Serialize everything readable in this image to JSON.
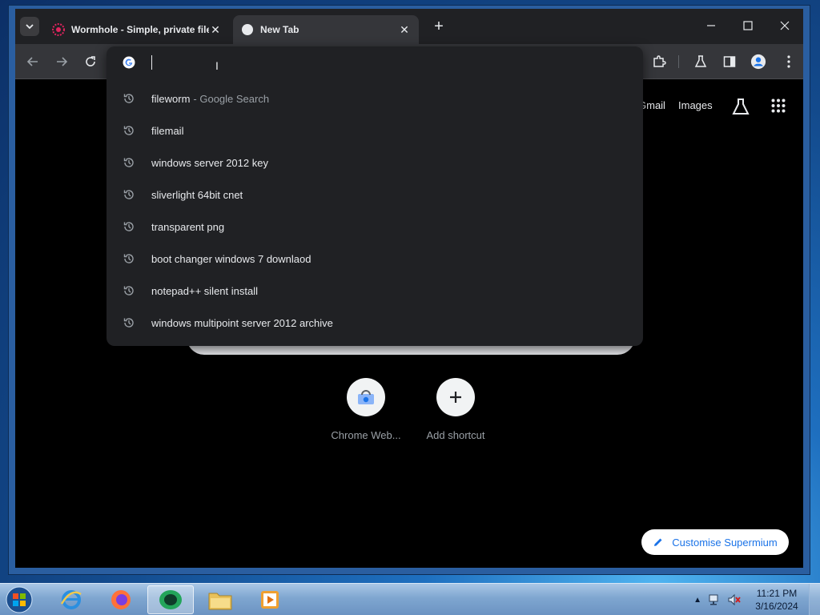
{
  "browser": {
    "tabs": [
      {
        "title": "Wormhole - Simple, private file",
        "active": false
      },
      {
        "title": "New Tab",
        "active": true
      }
    ]
  },
  "omnibox": {
    "value": "",
    "suggestions": [
      {
        "text": "fileworm",
        "sub": "- Google Search"
      },
      {
        "text": "filemail",
        "sub": ""
      },
      {
        "text": "windows server 2012 key",
        "sub": ""
      },
      {
        "text": "sliverlight 64bit cnet",
        "sub": ""
      },
      {
        "text": "transparent png",
        "sub": ""
      },
      {
        "text": "boot changer windows 7 downlaod",
        "sub": ""
      },
      {
        "text": "notepad++ silent install",
        "sub": ""
      },
      {
        "text": "windows multipoint server 2012 archive",
        "sub": ""
      }
    ]
  },
  "ntp": {
    "gmail": "Gmail",
    "images": "Images",
    "shortcuts": [
      {
        "label": "Chrome Web..."
      },
      {
        "label": "Add shortcut"
      }
    ],
    "customise_label": "Customise Supermium"
  },
  "taskbar": {
    "time": "11:21 PM",
    "date": "3/16/2024"
  },
  "colors": {
    "accent": "#1a73e8",
    "omnibox_bg": "#202124",
    "tab_active": "#35363a"
  }
}
